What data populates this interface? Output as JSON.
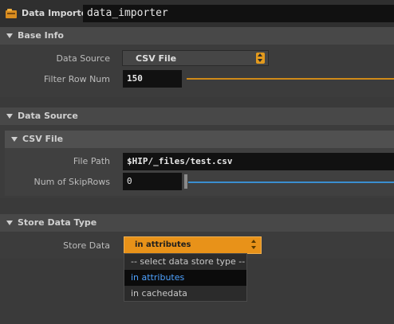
{
  "header": {
    "node_type": "Data Importer",
    "node_name": "data_importer"
  },
  "base_info": {
    "title": "Base Info",
    "data_source_label": "Data Source",
    "data_source_value": "CSV File",
    "filter_row_num_label": "Filter Row Num",
    "filter_row_num_value": "150"
  },
  "data_source_section": {
    "title": "Data Source",
    "csv_folder": {
      "title": "CSV File",
      "file_path_label": "File Path",
      "file_path_value": "$HIP/_files/test.csv",
      "skip_rows_label": "Num of SkipRows",
      "skip_rows_value": "0"
    }
  },
  "store_data_type": {
    "title": "Store Data Type",
    "store_data_label": "Store Data",
    "store_data_value": "in attributes",
    "options": [
      "-- select data store type --",
      "in attributes",
      "in cachedata"
    ],
    "highlighted_option": 1
  },
  "colors": {
    "accent_orange": "#e89219",
    "slider_orange": "#d08a18",
    "slider_blue": "#3a8fd0",
    "selection_blue": "#4ea2ff"
  }
}
